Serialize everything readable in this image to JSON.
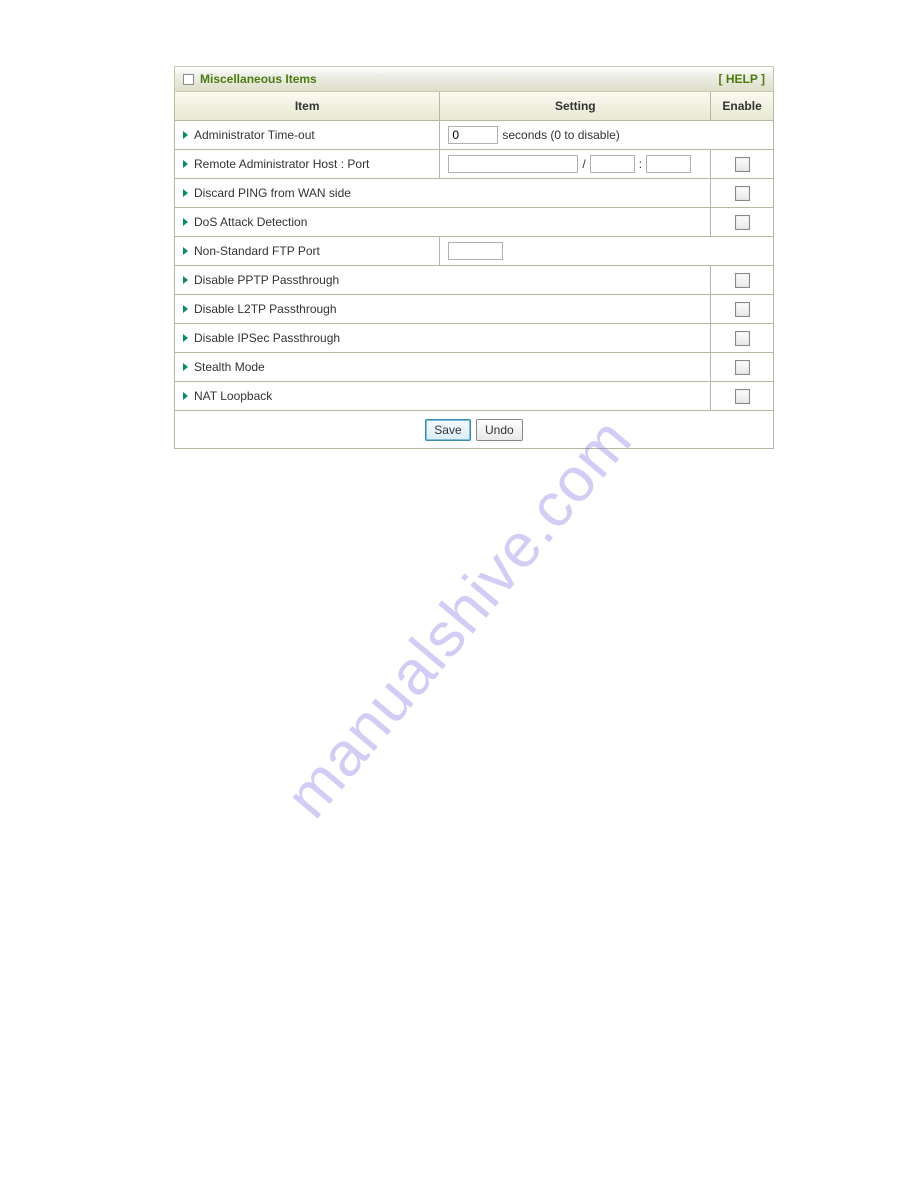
{
  "panel": {
    "title": "Miscellaneous Items",
    "help": "[ HELP ]"
  },
  "headers": {
    "item": "Item",
    "setting": "Setting",
    "enable": "Enable"
  },
  "rows": {
    "admin_timeout": {
      "label": "Administrator Time-out",
      "value": "0",
      "suffix": "seconds (0 to disable)"
    },
    "remote_admin": {
      "label": "Remote Administrator Host : Port",
      "host": "",
      "port1": "",
      "port2": "",
      "sep1": "/",
      "sep2": ":"
    },
    "discard_ping": {
      "label": "Discard PING from WAN side"
    },
    "dos_attack": {
      "label": "DoS Attack Detection"
    },
    "ftp_port": {
      "label": "Non-Standard FTP Port",
      "value": ""
    },
    "pptp": {
      "label": "Disable PPTP Passthrough"
    },
    "l2tp": {
      "label": "Disable L2TP Passthrough"
    },
    "ipsec": {
      "label": "Disable IPSec Passthrough"
    },
    "stealth": {
      "label": "Stealth Mode"
    },
    "nat_loopback": {
      "label": "NAT Loopback"
    }
  },
  "buttons": {
    "save": "Save",
    "undo": "Undo"
  },
  "watermark": "manualshive.com"
}
